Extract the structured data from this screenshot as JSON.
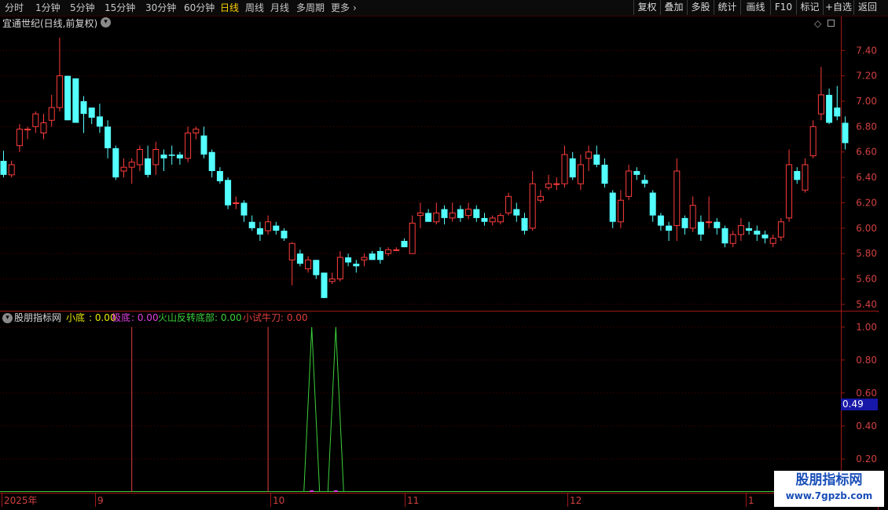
{
  "toolbar": {
    "periods": [
      "分时",
      "1分钟",
      "5分钟",
      "15分钟",
      "30分钟",
      "60分钟",
      "日线",
      "周线",
      "月线",
      "多周期",
      "更多"
    ],
    "active_period": "日线",
    "more_arrow": "›",
    "right_buttons": [
      "复权",
      "叠加",
      "多股",
      "统计",
      "画线",
      "F10",
      "标记",
      "+自选",
      "返回"
    ]
  },
  "price_panel": {
    "title": "宜通世纪(日线,前复权)",
    "y_ticks": [
      "7.40",
      "7.20",
      "7.00",
      "6.80",
      "6.60",
      "6.40",
      "6.20",
      "6.00",
      "5.80",
      "5.60",
      "5.40"
    ],
    "corner_icons": [
      "diamond-icon",
      "square-icon"
    ]
  },
  "indicator_panel": {
    "name": "股朋指标网",
    "series": [
      {
        "label": "小底",
        "value": "0.00",
        "color": "#e8e800"
      },
      {
        "label": "极底",
        "value": "0.00",
        "color": "#e040e0"
      },
      {
        "label": "火山反转底部",
        "value": "0.00",
        "color": "#3cd03c"
      },
      {
        "label": "小试牛刀",
        "value": "0.00",
        "color": "#e04040"
      }
    ],
    "y_ticks": [
      "1.00",
      "0.80",
      "0.60",
      "0.40",
      "0.20"
    ],
    "cursor_value": "0.49"
  },
  "date_axis": {
    "labels": [
      "2025年",
      "9",
      "10",
      "11",
      "12",
      "1"
    ]
  },
  "watermark": {
    "name": "股朋指标网",
    "url": "www.7gpzb.com"
  },
  "colors": {
    "up": "#ff3c3c",
    "down": "#54ffff",
    "grid": "#5a0000",
    "axis_text": "#d04040",
    "signal_green": "#3cd03c",
    "signal_red": "#e04040",
    "active_tab": "#ffd200"
  },
  "chart_data": {
    "type": "candlestick",
    "ylim": [
      5.35,
      7.55
    ],
    "candles": [
      [
        6.53,
        6.42,
        6.61,
        6.4
      ],
      [
        6.42,
        6.5,
        6.53,
        6.4
      ],
      [
        6.65,
        6.78,
        6.82,
        6.6
      ],
      [
        6.78,
        6.78,
        6.8,
        6.7
      ],
      [
        6.8,
        6.9,
        6.92,
        6.75
      ],
      [
        6.75,
        6.83,
        6.9,
        6.7
      ],
      [
        6.85,
        6.95,
        7.05,
        6.8
      ],
      [
        6.95,
        7.2,
        7.5,
        6.92
      ],
      [
        7.2,
        6.85,
        7.2,
        6.85
      ],
      [
        7.18,
        6.83,
        7.18,
        6.83
      ],
      [
        7.0,
        6.9,
        7.04,
        6.75
      ],
      [
        6.95,
        6.87,
        6.95,
        6.82
      ],
      [
        6.88,
        6.8,
        6.98,
        6.75
      ],
      [
        6.8,
        6.63,
        6.85,
        6.55
      ],
      [
        6.63,
        6.4,
        6.65,
        6.38
      ],
      [
        6.45,
        6.48,
        6.55,
        6.4
      ],
      [
        6.48,
        6.52,
        6.55,
        6.35
      ],
      [
        6.5,
        6.62,
        6.65,
        6.45
      ],
      [
        6.55,
        6.42,
        6.65,
        6.4
      ],
      [
        6.5,
        6.62,
        6.68,
        6.42
      ],
      [
        6.58,
        6.55,
        6.62,
        6.45
      ],
      [
        6.58,
        6.57,
        6.65,
        6.5
      ],
      [
        6.58,
        6.55,
        6.6,
        6.5
      ],
      [
        6.55,
        6.75,
        6.8,
        6.52
      ],
      [
        6.75,
        6.78,
        6.8,
        6.7
      ],
      [
        6.73,
        6.58,
        6.8,
        6.55
      ],
      [
        6.6,
        6.45,
        6.62,
        6.4
      ],
      [
        6.45,
        6.37,
        6.48,
        6.35
      ],
      [
        6.38,
        6.18,
        6.4,
        6.15
      ],
      [
        6.2,
        6.2,
        6.25,
        6.15
      ],
      [
        6.2,
        6.1,
        6.22,
        6.05
      ],
      [
        6.05,
        6.0,
        6.1,
        5.98
      ],
      [
        6.0,
        5.95,
        6.05,
        5.9
      ],
      [
        5.98,
        6.05,
        6.1,
        5.95
      ],
      [
        6.02,
        5.98,
        6.05,
        5.95
      ],
      [
        5.98,
        5.92,
        6.0,
        5.9
      ],
      [
        5.75,
        5.88,
        5.89,
        5.55
      ],
      [
        5.8,
        5.72,
        5.83,
        5.7
      ],
      [
        5.68,
        5.75,
        5.78,
        5.65
      ],
      [
        5.75,
        5.63,
        5.75,
        5.6
      ],
      [
        5.65,
        5.45,
        5.62,
        5.45
      ],
      [
        5.58,
        5.6,
        5.65,
        5.56
      ],
      [
        5.6,
        5.77,
        5.82,
        5.58
      ],
      [
        5.77,
        5.73,
        5.8,
        5.7
      ],
      [
        5.72,
        5.7,
        5.75,
        5.65
      ],
      [
        5.75,
        5.77,
        5.8,
        5.7
      ],
      [
        5.8,
        5.75,
        5.82,
        5.75
      ],
      [
        5.82,
        5.75,
        5.85,
        5.72
      ],
      [
        5.8,
        5.83,
        5.85,
        5.78
      ],
      [
        5.83,
        5.83,
        5.85,
        5.82
      ],
      [
        5.9,
        5.85,
        5.92,
        5.85
      ],
      [
        5.8,
        6.04,
        6.1,
        5.8
      ],
      [
        6.1,
        6.12,
        6.2,
        6.0
      ],
      [
        6.12,
        6.05,
        6.15,
        6.05
      ],
      [
        6.05,
        6.12,
        6.2,
        6.03
      ],
      [
        6.15,
        6.08,
        6.18,
        6.03
      ],
      [
        6.08,
        6.12,
        6.2,
        6.05
      ],
      [
        6.15,
        6.08,
        6.18,
        6.05
      ],
      [
        6.1,
        6.15,
        6.2,
        6.07
      ],
      [
        6.15,
        6.08,
        6.18,
        6.05
      ],
      [
        6.08,
        6.05,
        6.12,
        6.02
      ],
      [
        6.05,
        6.08,
        6.1,
        6.02
      ],
      [
        6.05,
        6.1,
        6.12,
        6.03
      ],
      [
        6.12,
        6.25,
        6.28,
        6.1
      ],
      [
        6.15,
        6.1,
        6.2,
        6.05
      ],
      [
        6.08,
        5.98,
        6.12,
        5.95
      ],
      [
        6.0,
        6.35,
        6.45,
        5.98
      ],
      [
        6.22,
        6.25,
        6.3,
        6.2
      ],
      [
        6.32,
        6.35,
        6.42,
        6.3
      ],
      [
        6.35,
        6.35,
        6.4,
        6.3
      ],
      [
        6.35,
        6.58,
        6.65,
        6.32
      ],
      [
        6.55,
        6.4,
        6.6,
        6.38
      ],
      [
        6.35,
        6.5,
        6.58,
        6.3
      ],
      [
        6.55,
        6.6,
        6.65,
        6.45
      ],
      [
        6.58,
        6.5,
        6.65,
        6.48
      ],
      [
        6.5,
        6.35,
        6.55,
        6.32
      ],
      [
        6.28,
        6.05,
        6.3,
        6.0
      ],
      [
        6.05,
        6.22,
        6.3,
        6.0
      ],
      [
        6.25,
        6.45,
        6.5,
        6.22
      ],
      [
        6.45,
        6.42,
        6.48,
        6.38
      ],
      [
        6.38,
        6.35,
        6.42,
        6.32
      ],
      [
        6.28,
        6.1,
        6.3,
        6.05
      ],
      [
        6.1,
        6.02,
        6.12,
        5.98
      ],
      [
        6.02,
        5.98,
        6.05,
        5.9
      ],
      [
        6.02,
        6.45,
        6.55,
        5.9
      ],
      [
        6.08,
        6.0,
        6.1,
        5.95
      ],
      [
        6.0,
        6.18,
        6.25,
        5.97
      ],
      [
        6.05,
        5.95,
        6.1,
        5.9
      ],
      [
        6.05,
        6.05,
        6.25,
        6.0
      ],
      [
        6.05,
        6.0,
        6.08,
        5.95
      ],
      [
        6.0,
        5.88,
        6.02,
        5.85
      ],
      [
        5.88,
        5.95,
        5.98,
        5.85
      ],
      [
        5.95,
        6.02,
        6.08,
        5.9
      ],
      [
        6.0,
        5.98,
        6.05,
        5.95
      ],
      [
        5.98,
        5.95,
        6.02,
        5.9
      ],
      [
        5.95,
        5.92,
        5.98,
        5.88
      ],
      [
        5.88,
        5.92,
        5.95,
        5.85
      ],
      [
        5.93,
        6.05,
        6.08,
        5.9
      ],
      [
        6.08,
        6.5,
        6.62,
        6.05
      ],
      [
        6.45,
        6.38,
        6.48,
        6.35
      ],
      [
        6.3,
        6.5,
        6.55,
        6.28
      ],
      [
        6.57,
        6.8,
        6.85,
        6.55
      ],
      [
        6.9,
        7.05,
        7.27,
        6.85
      ],
      [
        7.05,
        6.83,
        7.1,
        6.82
      ],
      [
        6.95,
        6.88,
        7.12,
        6.85
      ],
      [
        6.83,
        6.67,
        6.88,
        6.62
      ]
    ],
    "indicator": {
      "ylim": [
        0,
        1.08
      ],
      "red_spikes": [
        16,
        33
      ],
      "green_triangles": [
        38.5,
        41.5
      ]
    }
  }
}
